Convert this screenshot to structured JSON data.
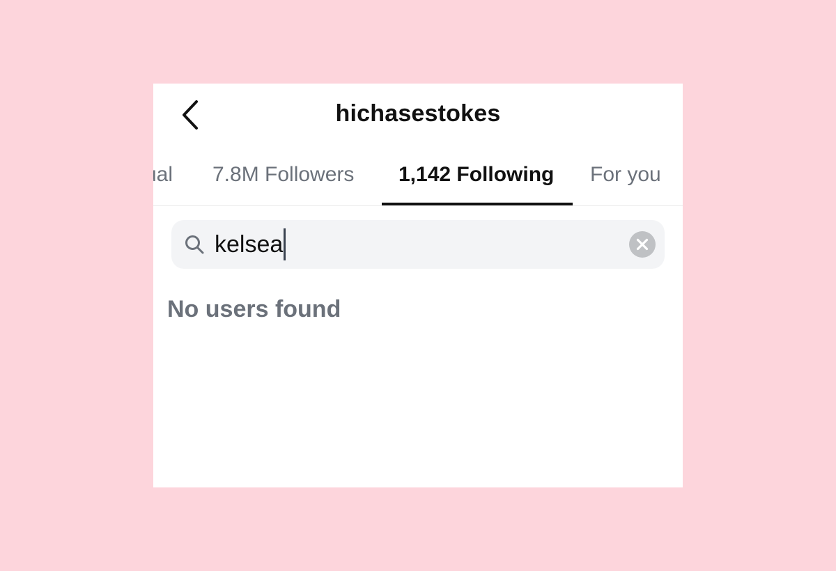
{
  "header": {
    "title": "hichasestokes",
    "back_icon": "chevron-left-icon"
  },
  "tabs": [
    {
      "label": "Mutual",
      "visible_label": "ual",
      "active": false
    },
    {
      "label": "7.8M Followers",
      "active": false
    },
    {
      "label": "1,142 Following",
      "active": true
    },
    {
      "label": "For you",
      "active": false
    }
  ],
  "search": {
    "value": "kelsea",
    "icon": "search-icon",
    "clear_icon": "clear-icon"
  },
  "results": {
    "empty_message": "No users found"
  },
  "colors": {
    "backdrop": "#fdd5dc",
    "surface": "#ffffff",
    "primary_text": "#111111",
    "secondary_text": "#6b717a",
    "search_background": "#f3f4f6",
    "clear_button": "#bfc1c4"
  }
}
